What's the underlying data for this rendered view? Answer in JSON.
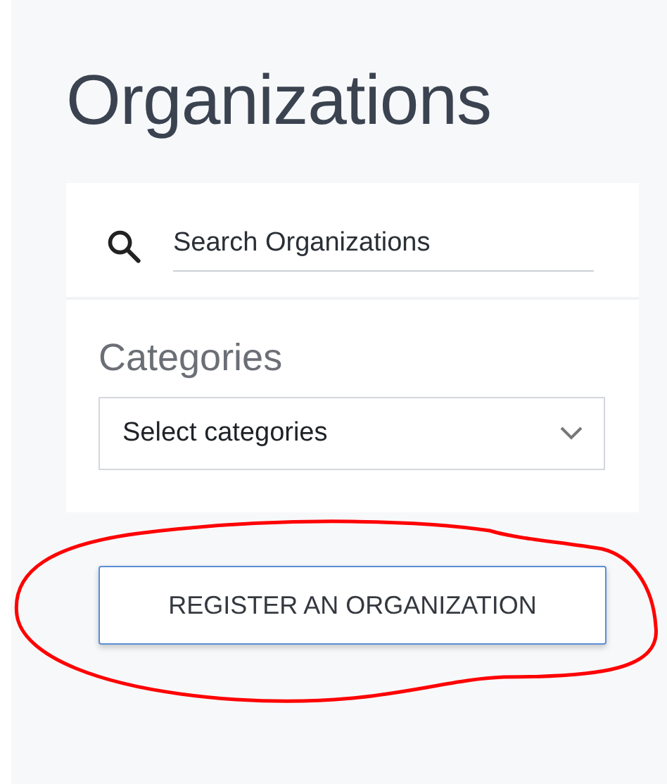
{
  "page": {
    "title": "Organizations"
  },
  "search": {
    "placeholder": "Search Organizations"
  },
  "categories": {
    "label": "Categories",
    "placeholder": "Select categories"
  },
  "register_button": {
    "label": "REGISTER AN ORGANIZATION"
  }
}
